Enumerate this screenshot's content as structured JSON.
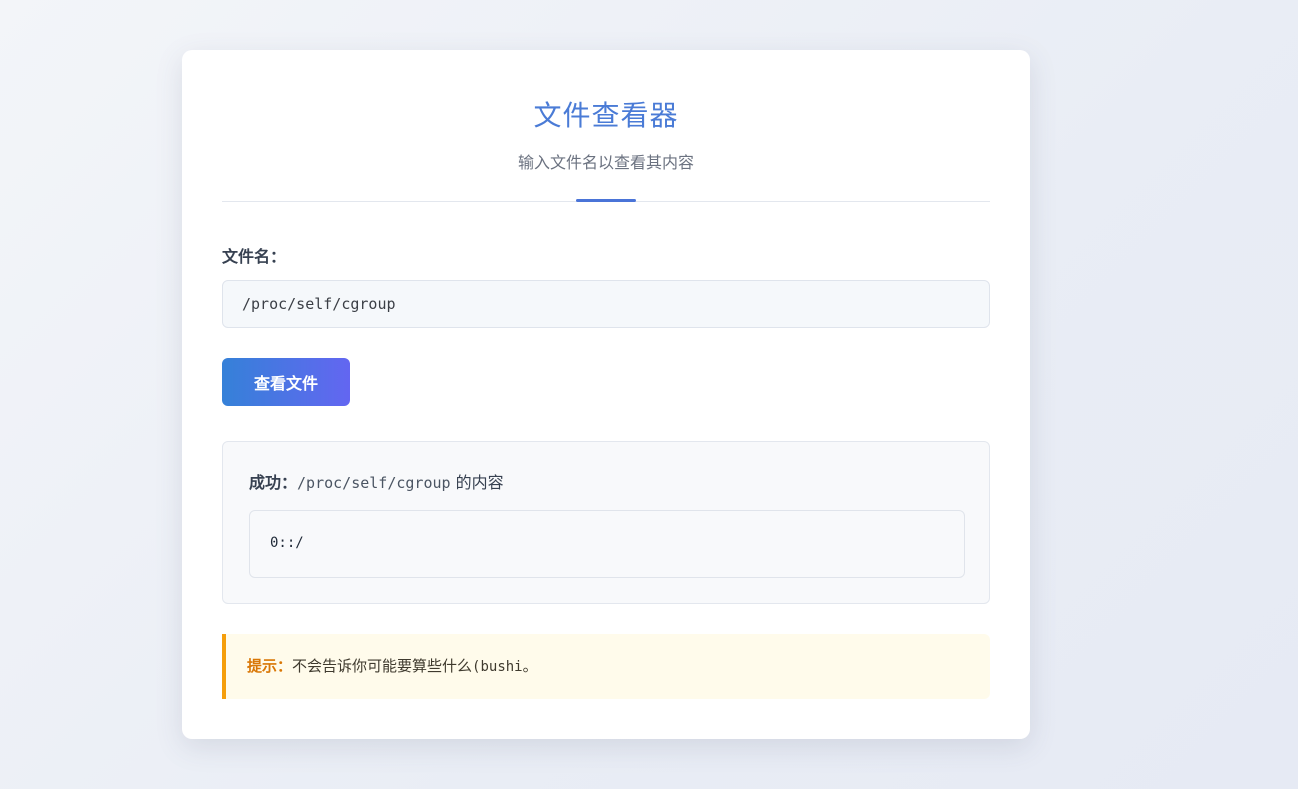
{
  "header": {
    "title": "文件查看器",
    "subtitle": "输入文件名以查看其内容"
  },
  "form": {
    "label": "文件名：",
    "input_value": "/proc/self/cgroup",
    "button_label": "查看文件"
  },
  "result": {
    "status_label": "成功：",
    "path": "/proc/self/cgroup",
    "suffix": " 的内容",
    "content": "0::/"
  },
  "hint": {
    "label": "提示：",
    "text_pre": "不会告诉你可能要算些什么",
    "text_mono": "(bushi",
    "text_post": "。"
  },
  "colors": {
    "accent": "#4a74d8",
    "button_gradient_start": "#3581d8",
    "button_gradient_end": "#6366f1",
    "hint_border": "#f59e0b",
    "hint_label": "#d97706"
  }
}
